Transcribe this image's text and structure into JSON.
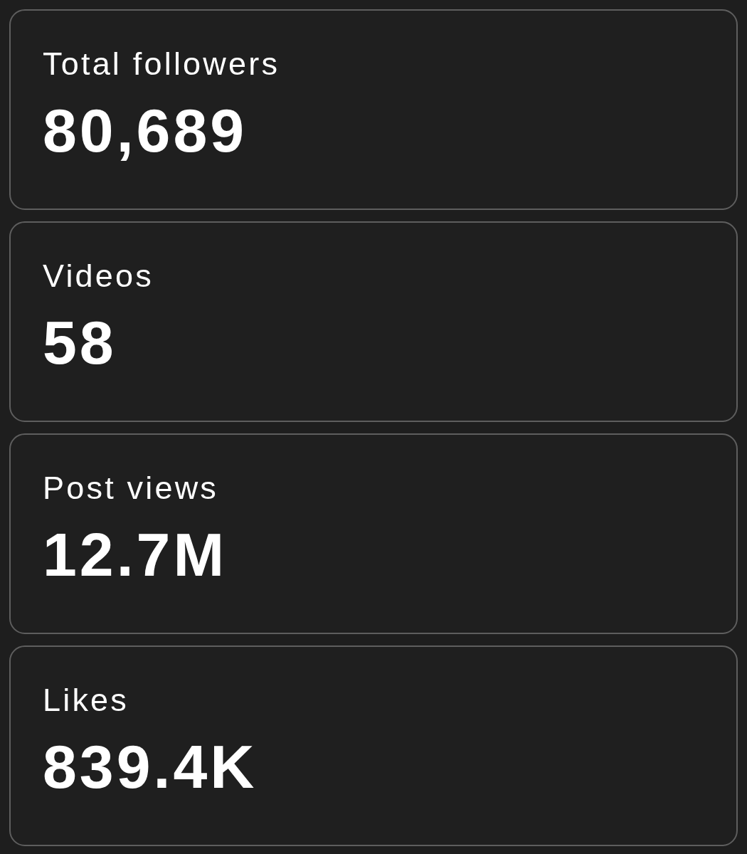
{
  "stats": [
    {
      "label": "Total followers",
      "value": "80,689"
    },
    {
      "label": "Videos",
      "value": "58"
    },
    {
      "label": "Post views",
      "value": "12.7M"
    },
    {
      "label": "Likes",
      "value": "839.4K"
    }
  ]
}
